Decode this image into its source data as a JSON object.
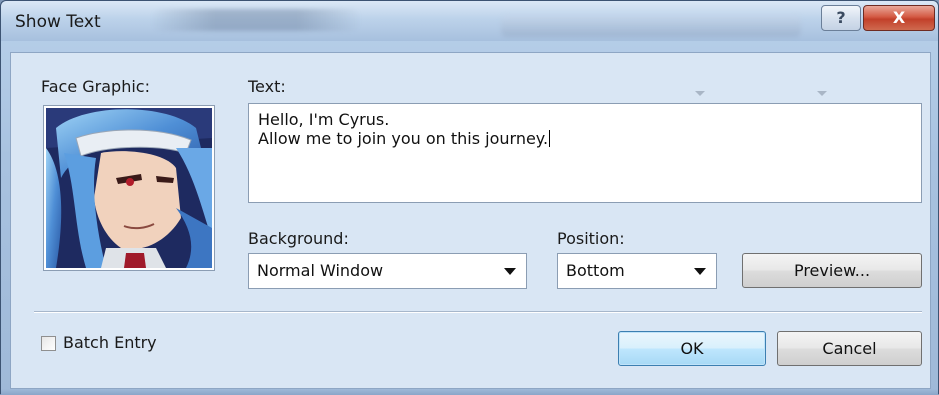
{
  "window": {
    "title": "Show Text",
    "help_label": "?",
    "close_label": "X"
  },
  "face": {
    "label": "Face Graphic:"
  },
  "text": {
    "label": "Text:",
    "lines": [
      "Hello, I'm Cyrus.",
      "Allow me to join you on this journey."
    ]
  },
  "background": {
    "label": "Background:",
    "selected": "Normal Window"
  },
  "position": {
    "label": "Position:",
    "selected": "Bottom"
  },
  "buttons": {
    "preview": "Preview...",
    "ok": "OK",
    "cancel": "Cancel"
  },
  "batch_entry": {
    "label": "Batch Entry",
    "checked": false
  },
  "colors": {
    "title_gradient_top": "#dbe8f6",
    "client_background": "#d9e6f4",
    "close_button": "#c2402a",
    "default_button": "#bee6fd"
  }
}
